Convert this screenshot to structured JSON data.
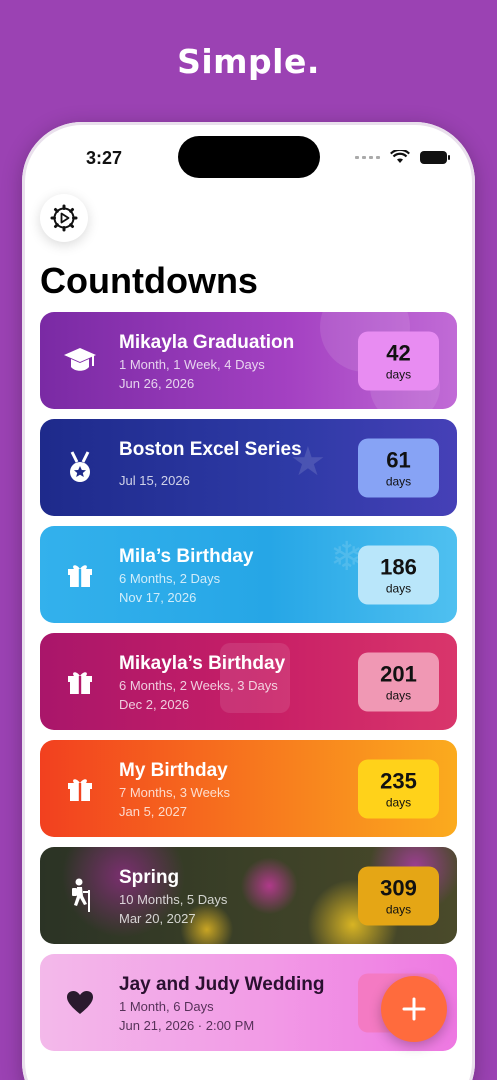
{
  "headline": "Simple.",
  "status_bar": {
    "time": "3:27"
  },
  "header": {
    "title": "Countdowns"
  },
  "countdowns": [
    {
      "title": "Mikayla Graduation",
      "subtitle": "1 Month, 1 Week, 4 Days",
      "date": "Jun 26, 2026",
      "days": "42",
      "unit": "days",
      "icon": "graduation-cap-icon",
      "colors": [
        "#7b2aa3",
        "#b44fc9"
      ],
      "badge_color": "#e88cf2"
    },
    {
      "title": "Boston Excel Series",
      "subtitle": "",
      "date": "Jul 15, 2026",
      "days": "61",
      "unit": "days",
      "icon": "medal-icon",
      "colors": [
        "#1f2a8a",
        "#3c3fb0"
      ],
      "badge_color": "#87a3f5"
    },
    {
      "title": "Mila’s Birthday",
      "subtitle": "6 Months, 2 Days",
      "date": "Nov 17, 2026",
      "days": "186",
      "unit": "days",
      "icon": "gift-icon",
      "colors": [
        "#2aa8e8",
        "#5ec4f2"
      ],
      "badge_color": "#b9e6fa"
    },
    {
      "title": "Mikayla’s Birthday",
      "subtitle": "6 Months, 2 Weeks, 3 Days",
      "date": "Dec 2, 2026",
      "days": "201",
      "unit": "days",
      "icon": "gift-icon",
      "colors": [
        "#b3186a",
        "#d9366b"
      ],
      "badge_color": "#f098b4"
    },
    {
      "title": "My Birthday",
      "subtitle": "7 Months, 3 Weeks",
      "date": "Jan 5, 2027",
      "days": "235",
      "unit": "days",
      "icon": "gift-icon",
      "colors": [
        "#f2431f",
        "#fbab1e"
      ],
      "badge_color": "#ffd21a"
    },
    {
      "title": "Spring",
      "subtitle": "10 Months, 5 Days",
      "date": "Mar 20, 2027",
      "days": "309",
      "unit": "days",
      "icon": "hiker-icon",
      "colors": [
        "#2a3322",
        "#55502a"
      ],
      "badge_color": "#e5a615"
    },
    {
      "title": "Jay and Judy Wedding",
      "subtitle": "1 Month, 6 Days",
      "date": "Jun 21, 2026 · 2:00 PM",
      "days": "",
      "unit": "",
      "icon": "heart-icon",
      "colors": [
        "#f4b4e8",
        "#f07fe6"
      ],
      "badge_color": "#f47ac3"
    }
  ],
  "add_button": {
    "label": "+"
  }
}
